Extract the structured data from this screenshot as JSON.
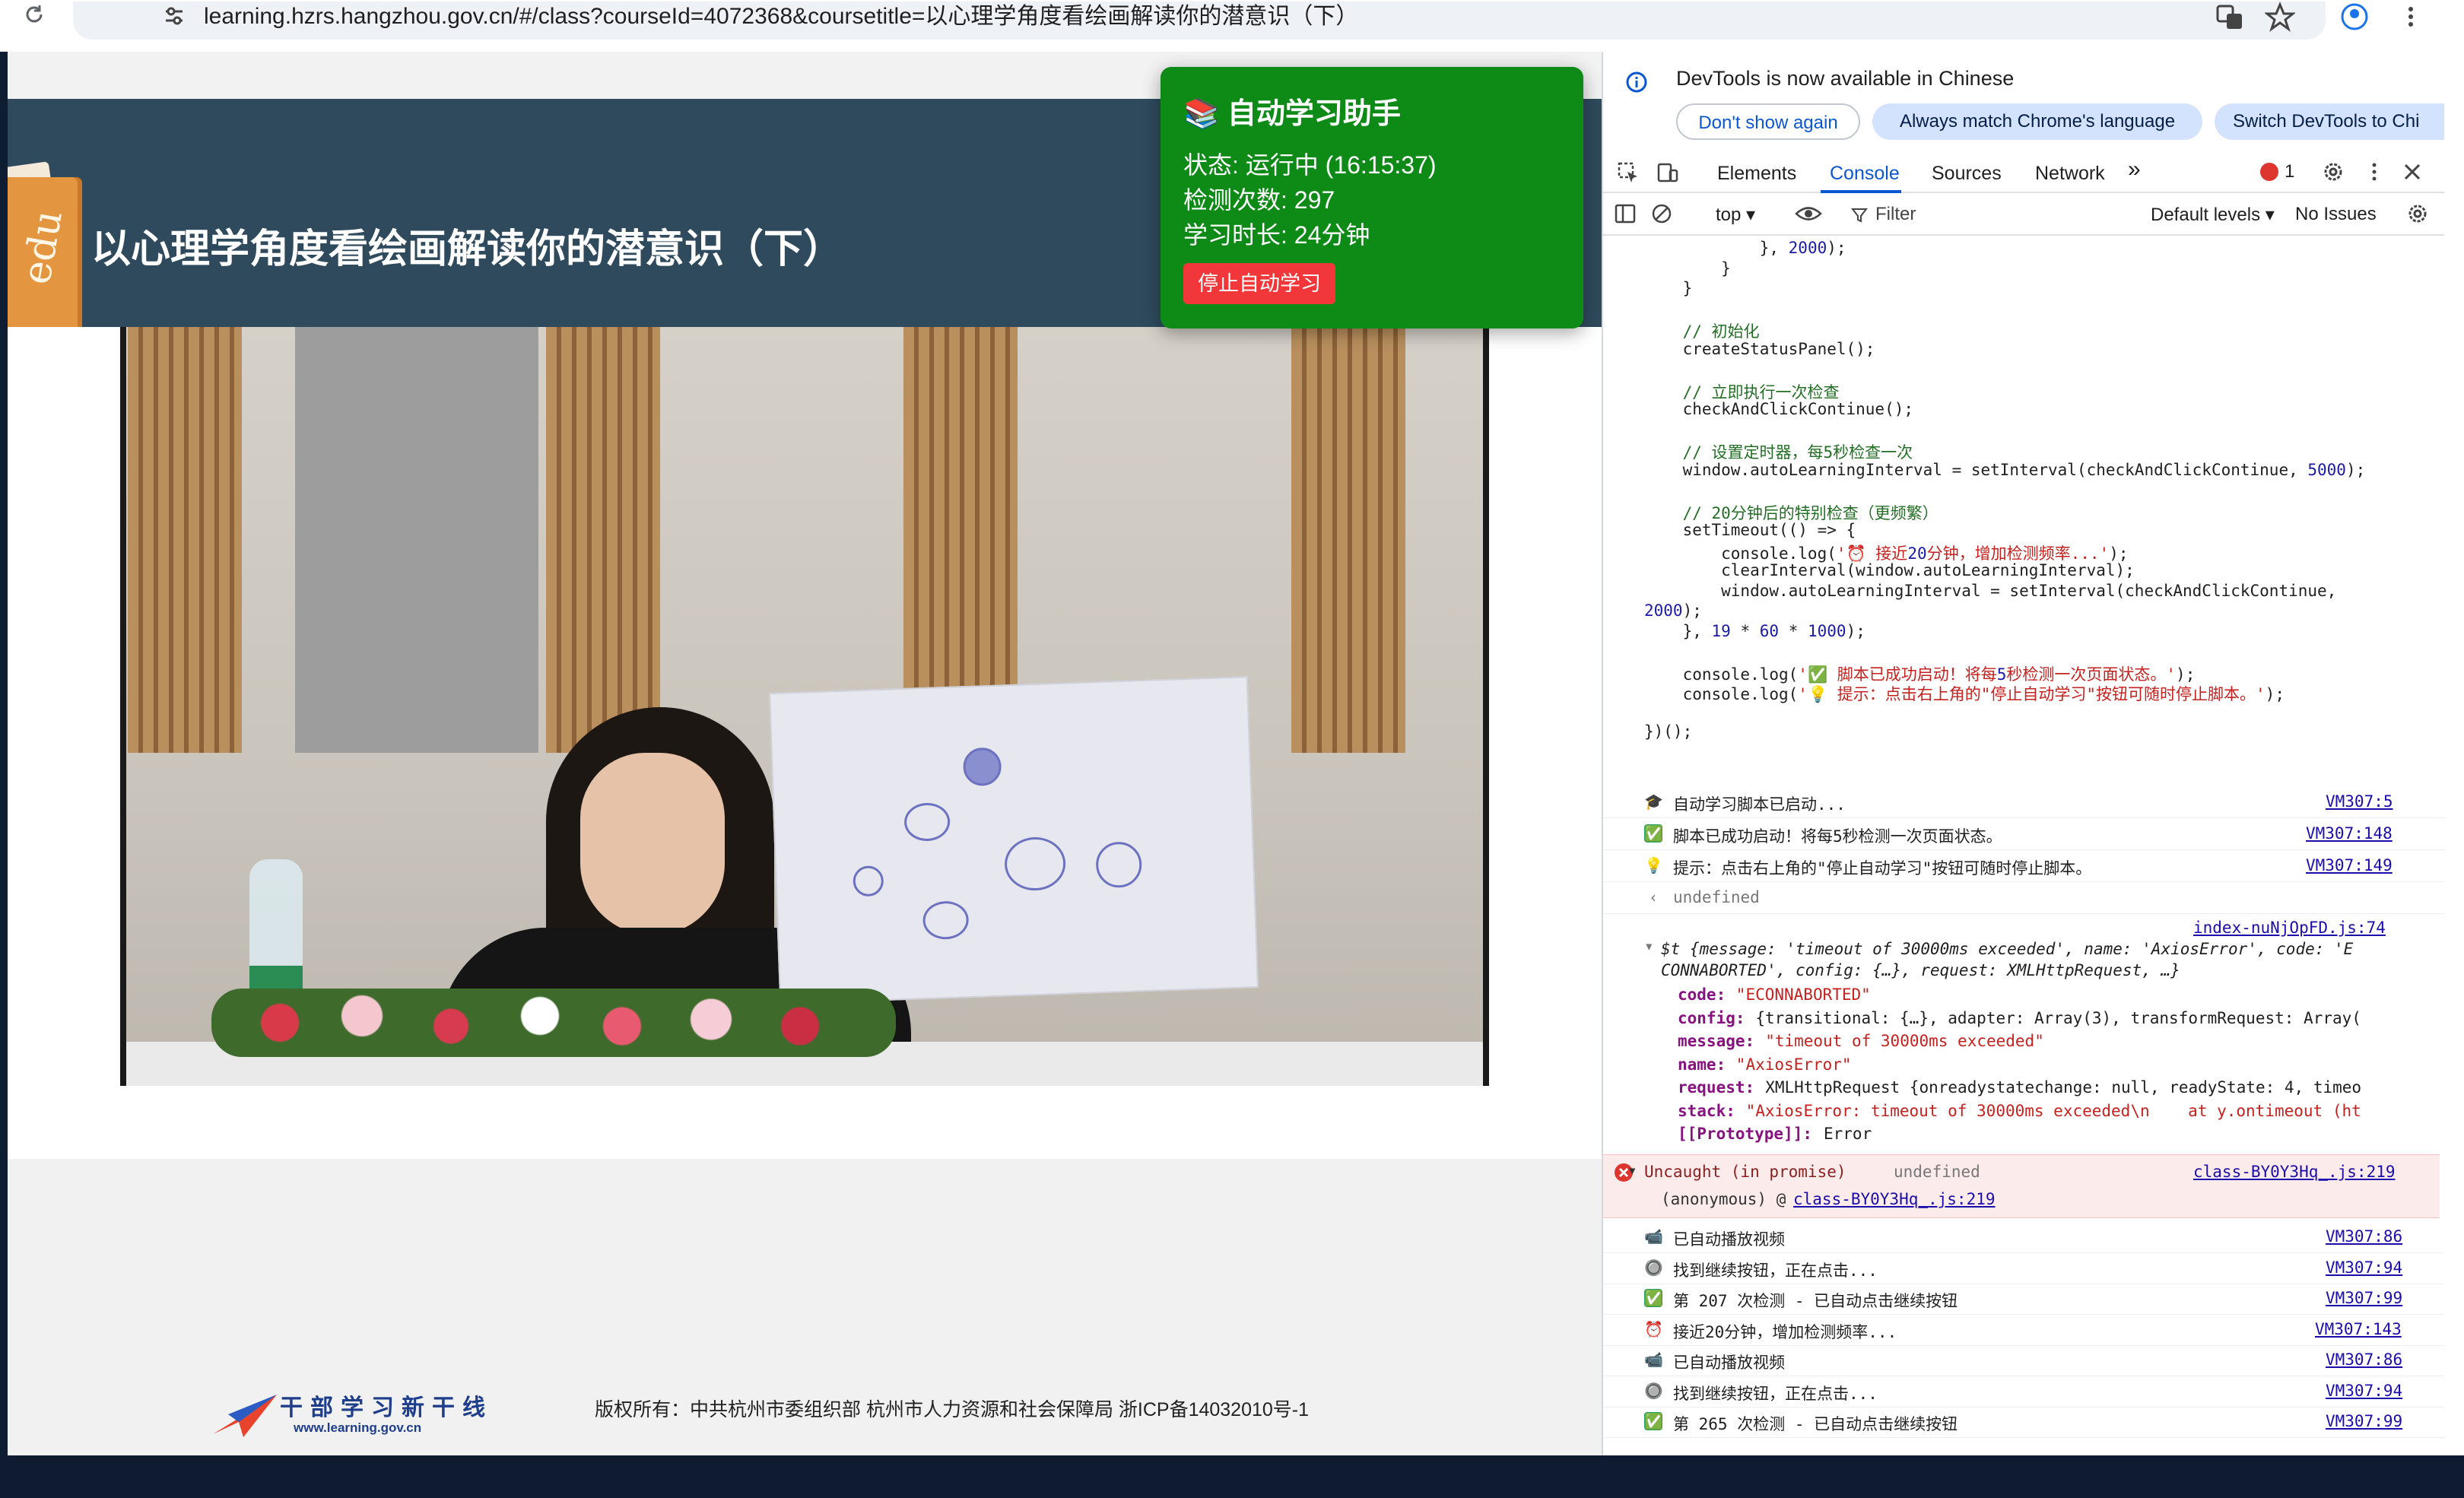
{
  "browser": {
    "url": "learning.hzrs.hangzhou.gov.cn/#/class?courseId=4072368&coursetitle=以心理学角度看绘画解读你的潜意识（下）"
  },
  "page": {
    "logo_badge": "edu",
    "course_title": "以心理学角度看绘画解读你的潜意识（下）",
    "footer_logo_main": "干部学习新干线",
    "footer_logo_sub": "www.learning.gov.cn",
    "copyright": "版权所有：中共杭州市委组织部 杭州市人力资源和社会保障局 浙ICP备14032010号-1"
  },
  "assistant": {
    "title": "📚 自动学习助手",
    "status": "状态: 运行中 (16:15:37)",
    "checks": "检测次数: 297",
    "duration": "学习时长: 24分钟",
    "stop_button": "停止自动学习",
    "bg_color": "#0e8a17",
    "button_color": "#f2373b"
  },
  "devtools": {
    "banner": "DevTools is now available in Chinese",
    "dont_show": "Don't show again",
    "match_lang": "Always match Chrome's language",
    "switch": "Switch DevTools to Chi",
    "tabs": [
      "Elements",
      "Console",
      "Sources",
      "Network"
    ],
    "more_tabs": "»",
    "error_count": "1",
    "context": "top ▾",
    "filter_placeholder": "Filter",
    "levels": "Default levels ▾",
    "issues": "No Issues",
    "code": [
      "            }, 2000);",
      "        }",
      "    }",
      "",
      "    // 初始化",
      "    createStatusPanel();",
      "",
      "    // 立即执行一次检查",
      "    checkAndClickContinue();",
      "",
      "    // 设置定时器，每5秒检查一次",
      "    window.autoLearningInterval = setInterval(checkAndClickContinue, 5000);",
      "",
      "    // 20分钟后的特别检查（更频繁）",
      "    setTimeout(() => {",
      "        console.log('⏰ 接近20分钟，增加检测频率...');",
      "        clearInterval(window.autoLearningInterval);",
      "        window.autoLearningInterval = setInterval(checkAndClickContinue,",
      "2000);",
      "    }, 19 * 60 * 1000);",
      "",
      "    console.log('✅ 脚本已成功启动！将每5秒检测一次页面状态。');",
      "    console.log('💡 提示：点击右上角的\"停止自动学习\"按钮可随时停止脚本。');",
      "",
      "})();"
    ],
    "logs_top": [
      {
        "icon": "🎓",
        "text": "自动学习脚本已启动...",
        "src": "VM307:5"
      },
      {
        "icon": "✅",
        "text": "脚本已成功启动！将每5秒检测一次页面状态。",
        "src": "VM307:148"
      },
      {
        "icon": "💡",
        "text": "提示：点击右上角的\"停止自动学习\"按钮可随时停止脚本。",
        "src": "VM307:149"
      }
    ],
    "undefined_result": "undefined",
    "axios_src": "index-nuNjOpFD.js:74",
    "axios_summary": "$t {message: 'timeout of 30000ms exceeded', name: 'AxiosError', code: 'E",
    "axios_summary2": "CONNABORTED', config: {…}, request: XMLHttpRequest, …}",
    "axios_props": [
      {
        "key": "code:",
        "val": "\"ECONNABORTED\""
      },
      {
        "key": "config:",
        "val": "{transitional: {…}, adapter: Array(3), transformRequest: Array("
      },
      {
        "key": "message:",
        "val": "\"timeout of 30000ms exceeded\""
      },
      {
        "key": "name:",
        "val": "\"AxiosError\""
      },
      {
        "key": "request:",
        "val": "XMLHttpRequest {onreadystatechange: null, readyState: 4, timeo"
      },
      {
        "key": "stack:",
        "val": "\"AxiosError: timeout of 30000ms exceeded\\n    at y.ontimeout (ht"
      },
      {
        "key": "[[Prototype]]:",
        "val": "Error"
      }
    ],
    "error_title": "Uncaught (in promise)",
    "error_value": "undefined",
    "error_src": "class-BY0Y3Hq_.js:219",
    "error_stack_prefix": "(anonymous) @",
    "error_stack_link": "class-BY0Y3Hq_.js:219",
    "logs_bottom": [
      {
        "icon": "📹",
        "text": "已自动播放视频",
        "src": "VM307:86"
      },
      {
        "icon": "🔘",
        "text": "找到继续按钮，正在点击...",
        "src": "VM307:94"
      },
      {
        "icon": "✅",
        "text": "第 207 次检测 - 已自动点击继续按钮",
        "src": "VM307:99"
      },
      {
        "icon": "⏰",
        "text": "接近20分钟，增加检测频率...",
        "src": "VM307:143"
      },
      {
        "icon": "📹",
        "text": "已自动播放视频",
        "src": "VM307:86"
      },
      {
        "icon": "🔘",
        "text": "找到继续按钮，正在点击...",
        "src": "VM307:94"
      },
      {
        "icon": "✅",
        "text": "第 265 次检测 - 已自动点击继续按钮",
        "src": "VM307:99"
      }
    ],
    "prompt": "›"
  }
}
